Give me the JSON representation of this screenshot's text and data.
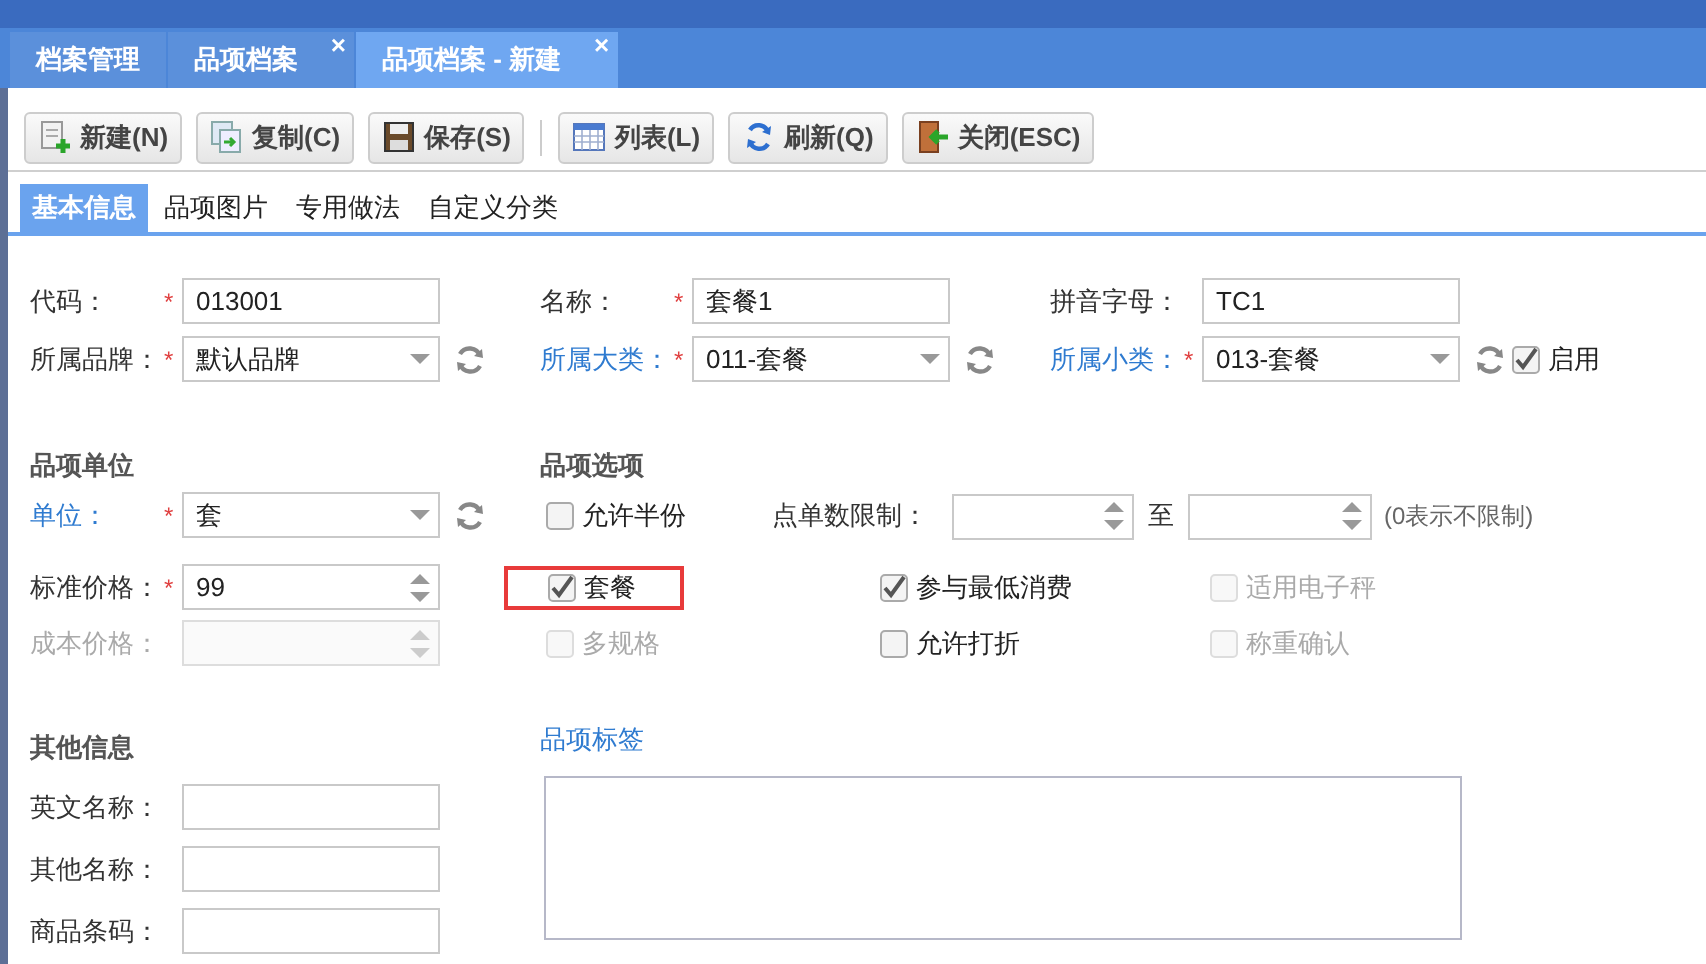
{
  "tabs": [
    {
      "label": "档案管理",
      "selected": false
    },
    {
      "label": "品项档案",
      "close": "×",
      "selected": false
    },
    {
      "label": "品项档案 - 新建",
      "close": "×",
      "selected": true
    }
  ],
  "toolbar": [
    {
      "label": "新建(N)"
    },
    {
      "label": "复制(C)"
    },
    {
      "label": "保存(S)"
    },
    {
      "label": "列表(L)"
    },
    {
      "label": "刷新(Q)"
    },
    {
      "label": "关闭(ESC)"
    }
  ],
  "subtabs": [
    {
      "label": "基本信息",
      "selected": true
    },
    {
      "label": "品项图片",
      "selected": false
    },
    {
      "label": "专用做法",
      "selected": false
    },
    {
      "label": "自定义分类",
      "selected": false
    }
  ],
  "main_fields": [
    {
      "label": "代码：",
      "required_mark": "*",
      "link": false,
      "kind": "text",
      "value": "013001"
    },
    {
      "label": "名称：",
      "required_mark": "*",
      "link": false,
      "kind": "text",
      "value": "套餐1"
    },
    {
      "label": "拼音字母：",
      "link": false,
      "kind": "text",
      "value": "TC1"
    },
    {
      "label": "所属品牌：",
      "required_mark": "*",
      "link": false,
      "kind": "select",
      "value": "默认品牌",
      "refresh": true
    },
    {
      "label": "所属大类：",
      "required_mark": "*",
      "link": true,
      "kind": "select",
      "value": "011-套餐",
      "refresh": true
    },
    {
      "label": "所属小类：",
      "required_mark": "*",
      "link": true,
      "kind": "select",
      "value": "013-套餐",
      "refresh": true
    }
  ],
  "enabled": {
    "label": "启用",
    "checked": true
  },
  "unit_section": {
    "title": "品项单位",
    "fields": [
      {
        "label": "单位：",
        "required_mark": "*",
        "link": true,
        "kind": "select",
        "value": "套",
        "refresh": true,
        "disabled": false
      },
      {
        "label": "标准价格：",
        "required_mark": "*",
        "link": false,
        "kind": "spinner",
        "value": "99",
        "disabled": false
      },
      {
        "label": "成本价格：",
        "link": false,
        "kind": "spinner",
        "disabled": true
      }
    ]
  },
  "options_section": {
    "title": "品项选项",
    "limit": {
      "label": "点单数限制：",
      "separator": "至",
      "hint": "(0表示不限制)"
    },
    "options": [
      {
        "label": "允许半份",
        "checked": false,
        "disabled": false,
        "highlighted": false
      },
      {
        "label": "套餐",
        "checked": true,
        "disabled": false,
        "highlighted": true
      },
      {
        "label": "参与最低消费",
        "checked": true,
        "disabled": false,
        "highlighted": false
      },
      {
        "label": "适用电子秤",
        "checked": false,
        "disabled": true,
        "highlighted": false
      },
      {
        "label": "多规格",
        "checked": false,
        "disabled": true,
        "highlighted": false
      },
      {
        "label": "允许打折",
        "checked": false,
        "disabled": false,
        "highlighted": false
      },
      {
        "label": "称重确认",
        "checked": false,
        "disabled": true,
        "highlighted": false
      }
    ]
  },
  "other_section": {
    "title": "其他信息",
    "fields": [
      {
        "label": "英文名称："
      },
      {
        "label": "其他名称："
      },
      {
        "label": "商品条码："
      }
    ]
  },
  "tags": {
    "label": "品项标签"
  }
}
